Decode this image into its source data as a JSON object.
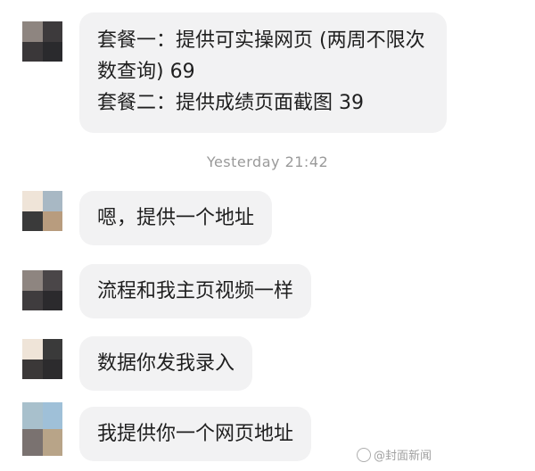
{
  "timestamp": "Yesterday 21:42",
  "messages": [
    {
      "lines": [
        "套餐一：提供可实操网页 (两周不限次",
        "数查询) 69",
        "套餐二：提供成绩页面截图 39"
      ],
      "avatar_colors": [
        "#8e8580",
        "#3d3a3c",
        "#3a3739",
        "#2a2a2d"
      ]
    },
    {
      "text": "嗯，提供一个地址",
      "avatar_colors": [
        "#efe4d8",
        "#a8b8c4",
        "#3a3a3a",
        "#b89c7e"
      ]
    },
    {
      "text": "流程和我主页视频一样",
      "avatar_colors": [
        "#8e8580",
        "#4a4648",
        "#3f3c3e",
        "#2b2a2d"
      ]
    },
    {
      "text": "数据你发我录入",
      "avatar_colors": [
        "#efe4d8",
        "#3a3a3a",
        "#3b3838",
        "#2c2b2d"
      ]
    },
    {
      "text": "我提供你一个网页地址",
      "avatar_colors": [
        "#a8c0cc",
        "#9fc0d8",
        "#7a7270",
        "#b8a488"
      ]
    }
  ],
  "watermark": "@封面新闻"
}
